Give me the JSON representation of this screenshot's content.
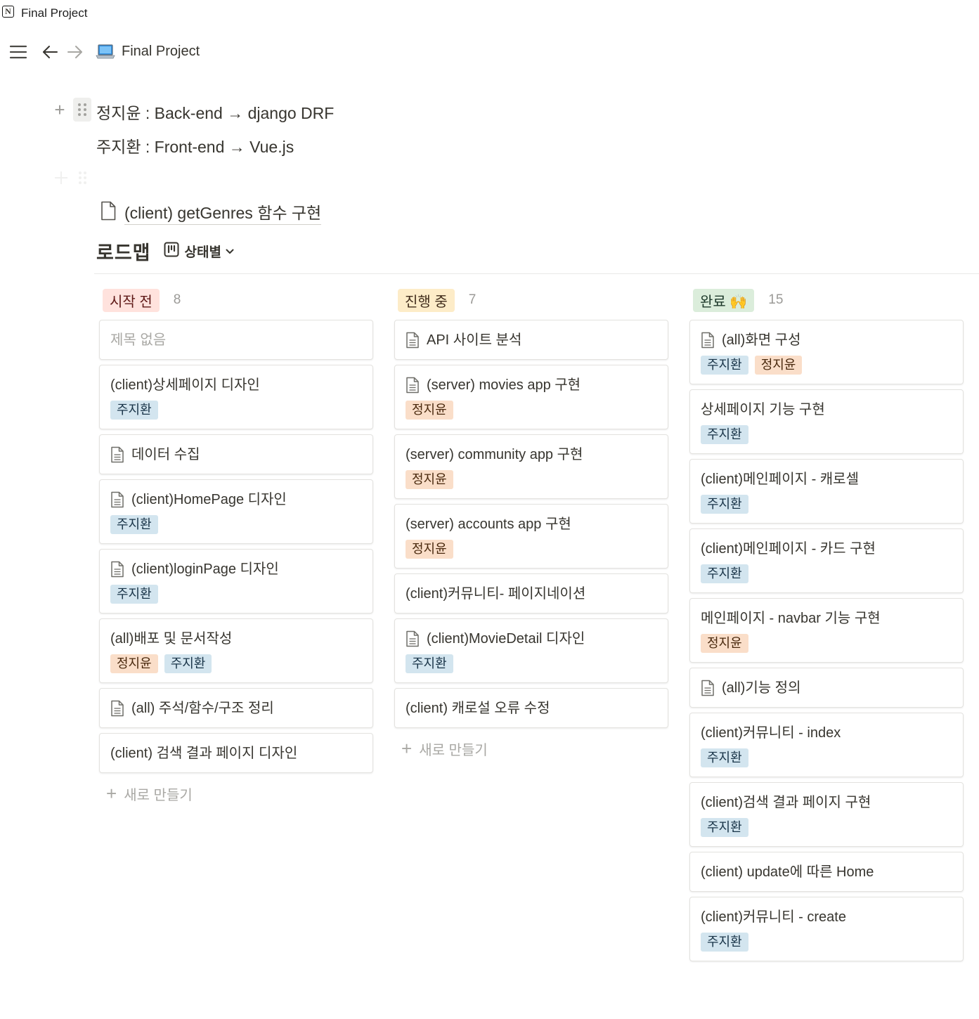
{
  "window": {
    "title": "Final Project"
  },
  "topbar": {
    "page_title": "Final Project",
    "page_icon": "laptop-icon"
  },
  "content": {
    "line1": "정지윤 : Back-end → django DRF",
    "line2": "주지환 : Front-end → Vue.js",
    "linked_page": "(client) getGenres 함수 구현"
  },
  "database": {
    "title": "로드맵",
    "view_label": "상태별",
    "new_label": "새로 만들기",
    "columns": [
      {
        "status": "시작 전",
        "count": "8",
        "bg": "#ffe2dd",
        "fg": "#5d1715",
        "cards": [
          {
            "title": "제목 없음",
            "icon": false,
            "empty": true,
            "tags": []
          },
          {
            "title": "(client)상세페이지 디자인",
            "icon": false,
            "tags": [
              {
                "label": "주지환",
                "color": "blue"
              }
            ]
          },
          {
            "title": "데이터 수집",
            "icon": true,
            "tags": []
          },
          {
            "title": "(client)HomePage 디자인",
            "icon": true,
            "tags": [
              {
                "label": "주지환",
                "color": "blue"
              }
            ]
          },
          {
            "title": "(client)loginPage 디자인",
            "icon": true,
            "tags": [
              {
                "label": "주지환",
                "color": "blue"
              }
            ]
          },
          {
            "title": "(all)배포 및 문서작성",
            "icon": false,
            "tags": [
              {
                "label": "정지윤",
                "color": "orange"
              },
              {
                "label": "주지환",
                "color": "blue"
              }
            ]
          },
          {
            "title": "(all) 주석/함수/구조 정리",
            "icon": true,
            "tags": []
          },
          {
            "title": "(client) 검색 결과 페이지 디자인",
            "icon": false,
            "tags": []
          }
        ],
        "show_new": true
      },
      {
        "status": "진행 중",
        "count": "7",
        "bg": "#fdecc8",
        "fg": "#402c1b",
        "cards": [
          {
            "title": "API 사이트 분석",
            "icon": true,
            "tags": []
          },
          {
            "title": "(server) movies app 구현",
            "icon": true,
            "tags": [
              {
                "label": "정지윤",
                "color": "orange"
              }
            ]
          },
          {
            "title": "(server) community app 구현",
            "icon": false,
            "tags": [
              {
                "label": "정지윤",
                "color": "orange"
              }
            ]
          },
          {
            "title": "(server) accounts app 구현",
            "icon": false,
            "tags": [
              {
                "label": "정지윤",
                "color": "orange"
              }
            ]
          },
          {
            "title": "(client)커뮤니티- 페이지네이션",
            "icon": false,
            "tags": []
          },
          {
            "title": "(client)MovieDetail 디자인",
            "icon": true,
            "tags": [
              {
                "label": "주지환",
                "color": "blue"
              }
            ]
          },
          {
            "title": "(client) 캐로설 오류 수정",
            "icon": false,
            "tags": []
          }
        ],
        "show_new": true
      },
      {
        "status": "완료 🙌",
        "count": "15",
        "bg": "#dbeddb",
        "fg": "#1c3829",
        "cards": [
          {
            "title": "(all)화면 구성",
            "icon": true,
            "tags": [
              {
                "label": "주지환",
                "color": "blue"
              },
              {
                "label": "정지윤",
                "color": "orange"
              }
            ]
          },
          {
            "title": "상세페이지 기능 구현",
            "icon": false,
            "tags": [
              {
                "label": "주지환",
                "color": "blue"
              }
            ]
          },
          {
            "title": "(client)메인페이지 - 캐로셀",
            "icon": false,
            "tags": [
              {
                "label": "주지환",
                "color": "blue"
              }
            ]
          },
          {
            "title": "(client)메인페이지 - 카드 구현",
            "icon": false,
            "tags": [
              {
                "label": "주지환",
                "color": "blue"
              }
            ]
          },
          {
            "title": "메인페이지 - navbar 기능 구현",
            "icon": false,
            "tags": [
              {
                "label": "정지윤",
                "color": "orange"
              }
            ]
          },
          {
            "title": "(all)기능 정의",
            "icon": true,
            "tags": []
          },
          {
            "title": "(client)커뮤니티 - index",
            "icon": false,
            "tags": [
              {
                "label": "주지환",
                "color": "blue"
              }
            ]
          },
          {
            "title": "(client)검색 결과 페이지 구현",
            "icon": false,
            "tags": [
              {
                "label": "주지환",
                "color": "blue"
              }
            ]
          },
          {
            "title": "(client) update에 따른 Home",
            "icon": false,
            "tags": []
          },
          {
            "title": "(client)커뮤니티 - create",
            "icon": false,
            "tags": [
              {
                "label": "주지환",
                "color": "blue"
              }
            ]
          }
        ],
        "show_new": false
      }
    ]
  }
}
